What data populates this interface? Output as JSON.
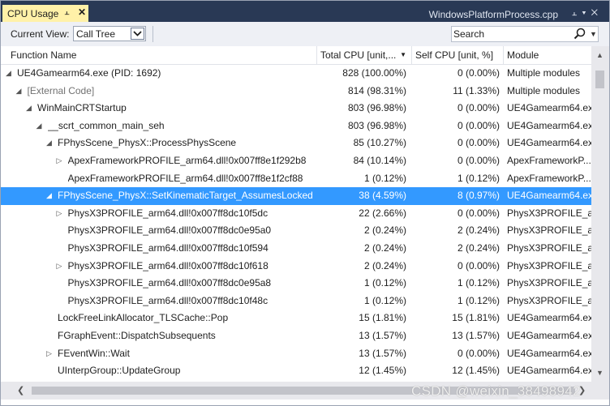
{
  "window": {
    "tab_title": "CPU Usage",
    "pin_icon": "pin-icon",
    "close_icon": "close-icon",
    "file_tab": "WindowsPlatformProcess.cpp"
  },
  "toolbar": {
    "current_view_label": "Current View:",
    "current_view_value": "Call Tree",
    "search_placeholder": "Search"
  },
  "columns": [
    {
      "label": "Function Name"
    },
    {
      "label": "Total CPU [unit,..."
    },
    {
      "label": "Self CPU [unit, %]"
    },
    {
      "label": "Module"
    }
  ],
  "rows": [
    {
      "name": "UE4Gamearm64.exe (PID: 1692)",
      "total": "828 (100.00%)",
      "self": "0 (0.00%)",
      "module": "Multiple modules",
      "indent": 0,
      "expander": "expanded"
    },
    {
      "name": "[External Code]",
      "total": "814 (98.31%)",
      "self": "11 (1.33%)",
      "module": "Multiple modules",
      "indent": 1,
      "expander": "expanded",
      "gray": true
    },
    {
      "name": "WinMainCRTStartup",
      "total": "803 (96.98%)",
      "self": "0 (0.00%)",
      "module": "UE4Gamearm64.exe",
      "indent": 2,
      "expander": "expanded"
    },
    {
      "name": "__scrt_common_main_seh",
      "total": "803 (96.98%)",
      "self": "0 (0.00%)",
      "module": "UE4Gamearm64.exe",
      "indent": 3,
      "expander": "expanded"
    },
    {
      "name": "FPhysScene_PhysX::ProcessPhysScene",
      "total": "85 (10.27%)",
      "self": "0 (0.00%)",
      "module": "UE4Gamearm64.exe",
      "indent": 4,
      "expander": "expanded"
    },
    {
      "name": "ApexFrameworkPROFILE_arm64.dll!0x007ff8e1f292b8",
      "total": "84 (10.14%)",
      "self": "0 (0.00%)",
      "module": "ApexFrameworkP...",
      "indent": 5,
      "expander": "collapsed"
    },
    {
      "name": "ApexFrameworkPROFILE_arm64.dll!0x007ff8e1f2cf88",
      "total": "1 (0.12%)",
      "self": "1 (0.12%)",
      "module": "ApexFrameworkP...",
      "indent": 5,
      "expander": "none"
    },
    {
      "name": "FPhysScene_PhysX::SetKinematicTarget_AssumesLocked",
      "total": "38 (4.59%)",
      "self": "8 (0.97%)",
      "module": "UE4Gamearm64.exe",
      "indent": 4,
      "expander": "expanded",
      "selected": true
    },
    {
      "name": "PhysX3PROFILE_arm64.dll!0x007ff8dc10f5dc",
      "total": "22 (2.66%)",
      "self": "0 (0.00%)",
      "module": "PhysX3PROFILE_ar...",
      "indent": 5,
      "expander": "collapsed"
    },
    {
      "name": "PhysX3PROFILE_arm64.dll!0x007ff8dc0e95a0",
      "total": "2 (0.24%)",
      "self": "2 (0.24%)",
      "module": "PhysX3PROFILE_ar...",
      "indent": 5,
      "expander": "none"
    },
    {
      "name": "PhysX3PROFILE_arm64.dll!0x007ff8dc10f594",
      "total": "2 (0.24%)",
      "self": "2 (0.24%)",
      "module": "PhysX3PROFILE_ar...",
      "indent": 5,
      "expander": "none"
    },
    {
      "name": "PhysX3PROFILE_arm64.dll!0x007ff8dc10f618",
      "total": "2 (0.24%)",
      "self": "0 (0.00%)",
      "module": "PhysX3PROFILE_ar...",
      "indent": 5,
      "expander": "collapsed"
    },
    {
      "name": "PhysX3PROFILE_arm64.dll!0x007ff8dc0e95a8",
      "total": "1 (0.12%)",
      "self": "1 (0.12%)",
      "module": "PhysX3PROFILE_ar...",
      "indent": 5,
      "expander": "none"
    },
    {
      "name": "PhysX3PROFILE_arm64.dll!0x007ff8dc10f48c",
      "total": "1 (0.12%)",
      "self": "1 (0.12%)",
      "module": "PhysX3PROFILE_ar...",
      "indent": 5,
      "expander": "none"
    },
    {
      "name": "LockFreeLinkAllocator_TLSCache::Pop",
      "total": "15 (1.81%)",
      "self": "15 (1.81%)",
      "module": "UE4Gamearm64.exe",
      "indent": 4,
      "expander": "none"
    },
    {
      "name": "FGraphEvent::DispatchSubsequents",
      "total": "13 (1.57%)",
      "self": "13 (1.57%)",
      "module": "UE4Gamearm64.exe",
      "indent": 4,
      "expander": "none"
    },
    {
      "name": "FEventWin::Wait",
      "total": "13 (1.57%)",
      "self": "0 (0.00%)",
      "module": "UE4Gamearm64.exe",
      "indent": 4,
      "expander": "collapsed"
    },
    {
      "name": "UInterpGroup::UpdateGroup",
      "total": "12 (1.45%)",
      "self": "12 (1.45%)",
      "module": "UE4Gamearm64.exe",
      "indent": 4,
      "expander": "none"
    }
  ],
  "watermark": "CSDN @weixin_38498942",
  "colors": {
    "title_bar": "#293955",
    "active_tab": "#fff1a8",
    "selection": "#3399ff"
  }
}
